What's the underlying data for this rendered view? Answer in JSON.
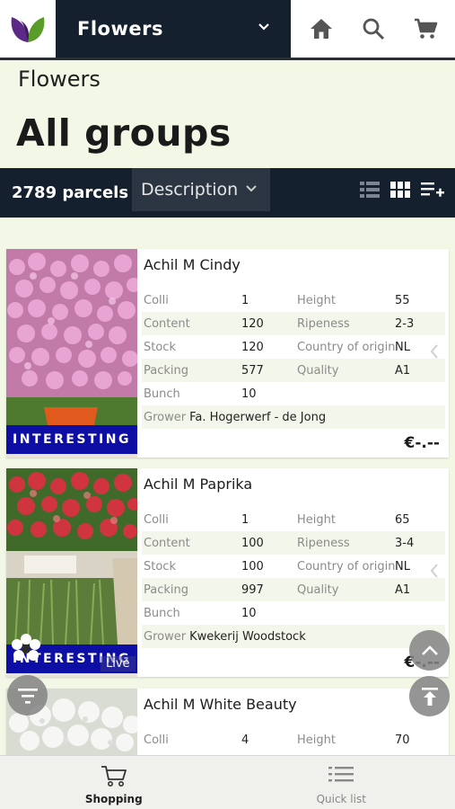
{
  "header": {
    "app_title": "Flowers",
    "breadcrumb": "Flowers",
    "heading": "All groups"
  },
  "filter": {
    "parcel_count": "2789 parcels",
    "sort_value": "Description"
  },
  "products": [
    {
      "name": "Achil M Cindy",
      "badge": "INTERESTING",
      "colli_label": "Colli",
      "colli": "1",
      "height_label": "Height",
      "height": "55",
      "content_label": "Content",
      "content": "120",
      "ripeness_label": "Ripeness",
      "ripeness": "2-3",
      "stock_label": "Stock",
      "stock": "120",
      "origin_label": "Country of origin",
      "origin": "NL",
      "packing_label": "Packing",
      "packing": "577",
      "quality_label": "Quality",
      "quality": "A1",
      "bunch_label": "Bunch",
      "bunch": "10",
      "grower_label": "Grower",
      "grower": "Fa. Hogerwerf - de Jong",
      "price": "€-.--",
      "flower_color": "#d98cc0"
    },
    {
      "name": "Achil M Paprika",
      "badge": "INTERESTING",
      "colli_label": "Colli",
      "colli": "1",
      "height_label": "Height",
      "height": "65",
      "content_label": "Content",
      "content": "100",
      "ripeness_label": "Ripeness",
      "ripeness": "3-4",
      "stock_label": "Stock",
      "stock": "100",
      "origin_label": "Country of origin",
      "origin": "NL",
      "packing_label": "Packing",
      "packing": "997",
      "quality_label": "Quality",
      "quality": "A1",
      "bunch_label": "Bunch",
      "bunch": "10",
      "grower_label": "Grower",
      "grower": "Kwekerij Woodstock",
      "price": "€-.--",
      "live_label": "Live",
      "flower_color": "#c9323c"
    },
    {
      "name": "Achil M White Beauty",
      "colli_label": "Colli",
      "colli": "4",
      "height_label": "Height",
      "height": "70",
      "flower_color": "#f1f1f1"
    }
  ],
  "bottom_nav": [
    {
      "label": "Shopping",
      "icon": "cart-icon"
    },
    {
      "label": "Quick list",
      "icon": "list-icon"
    }
  ],
  "colors": {
    "navy": "#14202d",
    "badge_blue": "#0d0ea3",
    "background": "#f2f7e6",
    "logo_purple": "#5b2a86",
    "logo_green": "#5a9c2a"
  }
}
